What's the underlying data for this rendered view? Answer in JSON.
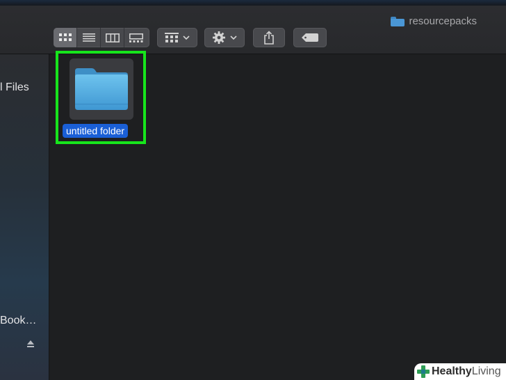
{
  "window": {
    "title": "resourcepacks"
  },
  "toolbar": {
    "view_buttons": [
      "icon-view-icon",
      "list-view-icon",
      "column-view-icon",
      "gallery-view-icon"
    ],
    "group_button": "group-icon",
    "action_button": "gear-icon",
    "share_button": "share-icon",
    "tag_button": "tag-icon"
  },
  "sidebar": {
    "items": [
      {
        "label": "l Files"
      },
      {
        "label": "Book…"
      }
    ]
  },
  "content": {
    "items": [
      {
        "name": "untitled folder",
        "icon": "folder-icon",
        "selected": true
      }
    ]
  },
  "watermark": {
    "brand_bold": "Healthy",
    "brand_light": "Living"
  },
  "colors": {
    "highlight": "#17e51c",
    "selection": "#1a5fd6",
    "folder": "#4fa9e0"
  }
}
